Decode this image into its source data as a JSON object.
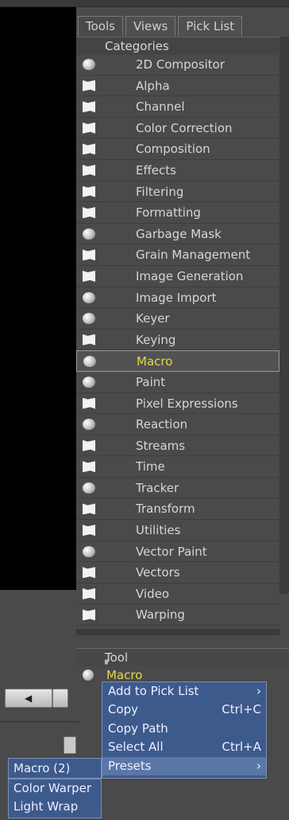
{
  "tabs": [
    {
      "label": "Tools"
    },
    {
      "label": "Views"
    },
    {
      "label": "Pick List"
    }
  ],
  "categories_header": "Categories",
  "categories": [
    {
      "label": "2D Compositor",
      "icon": "ball"
    },
    {
      "label": "Alpha",
      "icon": "folder"
    },
    {
      "label": "Channel",
      "icon": "folder"
    },
    {
      "label": "Color Correction",
      "icon": "folder"
    },
    {
      "label": "Composition",
      "icon": "folder"
    },
    {
      "label": "Effects",
      "icon": "folder"
    },
    {
      "label": "Filtering",
      "icon": "folder"
    },
    {
      "label": "Formatting",
      "icon": "folder"
    },
    {
      "label": "Garbage Mask",
      "icon": "ball"
    },
    {
      "label": "Grain Management",
      "icon": "folder"
    },
    {
      "label": "Image Generation",
      "icon": "folder"
    },
    {
      "label": "Image Import",
      "icon": "ball"
    },
    {
      "label": "Keyer",
      "icon": "ball"
    },
    {
      "label": "Keying",
      "icon": "folder"
    },
    {
      "label": "Macro",
      "icon": "ball",
      "selected": true
    },
    {
      "label": "Paint",
      "icon": "ball"
    },
    {
      "label": "Pixel Expressions",
      "icon": "folder"
    },
    {
      "label": "Reaction",
      "icon": "ball"
    },
    {
      "label": "Streams",
      "icon": "folder"
    },
    {
      "label": "Time",
      "icon": "folder"
    },
    {
      "label": "Tracker",
      "icon": "ball"
    },
    {
      "label": "Transform",
      "icon": "folder"
    },
    {
      "label": "Utilities",
      "icon": "folder"
    },
    {
      "label": "Vector Paint",
      "icon": "ball"
    },
    {
      "label": "Vectors",
      "icon": "folder"
    },
    {
      "label": "Video",
      "icon": "folder"
    },
    {
      "label": "Warping",
      "icon": "folder"
    }
  ],
  "tool_header": "Tool",
  "tool_row": {
    "label": "Macro",
    "icon": "ball"
  },
  "context_menu": [
    {
      "label": "Add to Pick List",
      "shortcut": "",
      "arrow": "›"
    },
    {
      "label": "Copy",
      "shortcut": "Ctrl+C",
      "arrow": ""
    },
    {
      "label": "Copy Path",
      "shortcut": "",
      "arrow": ""
    },
    {
      "label": "Select All",
      "shortcut": "Ctrl+A",
      "arrow": ""
    },
    {
      "label": "Presets",
      "shortcut": "",
      "arrow": "›",
      "highlighted": true
    }
  ],
  "presets_submenu": {
    "title": "Macro (2)",
    "items": [
      "Color Warper",
      "Light Wrap"
    ]
  },
  "nav_button_glyph": "◀"
}
